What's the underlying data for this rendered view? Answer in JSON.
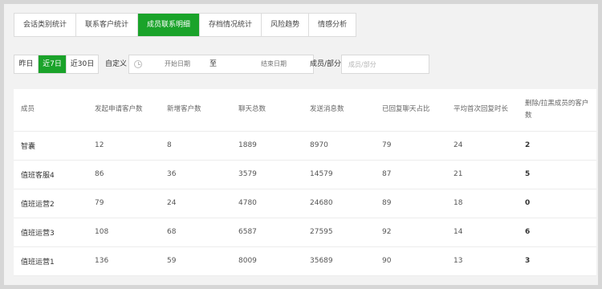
{
  "tabs": [
    {
      "label": "会话类别统计",
      "active": false
    },
    {
      "label": "联系客户统计",
      "active": false
    },
    {
      "label": "成员联系明细",
      "active": true
    },
    {
      "label": "存档情况统计",
      "active": false
    },
    {
      "label": "风险趋势",
      "active": false
    },
    {
      "label": "情感分析",
      "active": false
    }
  ],
  "filters": {
    "range_buttons": [
      {
        "label": "昨日",
        "active": false
      },
      {
        "label": "近7日",
        "active": true
      },
      {
        "label": "近30日",
        "active": false
      }
    ],
    "custom_label": "自定义",
    "start_placeholder": "开始日期",
    "range_separator": "至",
    "end_placeholder": "结束日期",
    "member_label": "成员/部分",
    "member_placeholder": "成员/部分"
  },
  "table": {
    "headers": [
      "成员",
      "发起申请客户数",
      "新增客户数",
      "聊天总数",
      "发送消息数",
      "已回复聊天占比",
      "平均首次回复时长",
      "删除/拉黑成员的客户数"
    ],
    "rows": [
      [
        "智囊",
        "12",
        "8",
        "1889",
        "8970",
        "79",
        "24",
        "2"
      ],
      [
        "值班客服4",
        "86",
        "36",
        "3579",
        "14579",
        "87",
        "21",
        "5"
      ],
      [
        "值班运营2",
        "79",
        "24",
        "4780",
        "24680",
        "89",
        "18",
        "0"
      ],
      [
        "值班运营3",
        "108",
        "68",
        "6587",
        "27595",
        "92",
        "14",
        "6"
      ],
      [
        "值班运营1",
        "136",
        "59",
        "8009",
        "35689",
        "90",
        "13",
        "3"
      ]
    ]
  },
  "colors": {
    "accent": "#1aa32a"
  }
}
